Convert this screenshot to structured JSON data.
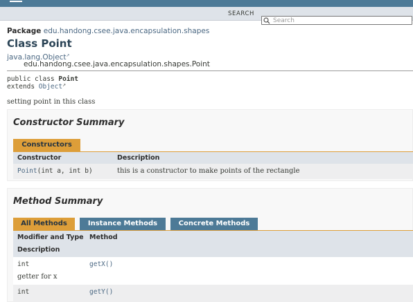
{
  "search": {
    "label": "SEARCH",
    "placeholder": "Search"
  },
  "package": {
    "label": "Package",
    "name": "edu.handong.csee.java.encapsulation.shapes"
  },
  "page_title": "Class Point",
  "inheritance": [
    {
      "name": "java.lang.Object",
      "external": true
    },
    {
      "name": "edu.handong.csee.java.encapsulation.shapes.Point",
      "external": false
    }
  ],
  "signature": {
    "decl_prefix": "public class ",
    "class_name": "Point",
    "extends_prefix": "extends ",
    "superclass": "Object"
  },
  "class_description": "setting point in this class",
  "constructor_summary": {
    "title": "Constructor Summary",
    "tab": "Constructors",
    "headers": [
      "Constructor",
      "Description"
    ],
    "rows": [
      {
        "name": "Point",
        "params": "(int a, int b)",
        "description": "this is a constructor to make points of the rectangle"
      }
    ]
  },
  "method_summary": {
    "title": "Method Summary",
    "tabs": [
      "All Methods",
      "Instance Methods",
      "Concrete Methods"
    ],
    "active_tab": "All Methods",
    "headers": [
      "Modifier and Type",
      "Method",
      "Description"
    ],
    "rows": [
      {
        "type": "int",
        "method": "getX()",
        "description": "getter for x"
      },
      {
        "type": "int",
        "method": "getY()",
        "description": ""
      }
    ]
  },
  "colors": {
    "nav": "#4d7a97",
    "subnav": "#dee3e9",
    "active_tab": "#dd9e39",
    "link": "#4a6782"
  }
}
